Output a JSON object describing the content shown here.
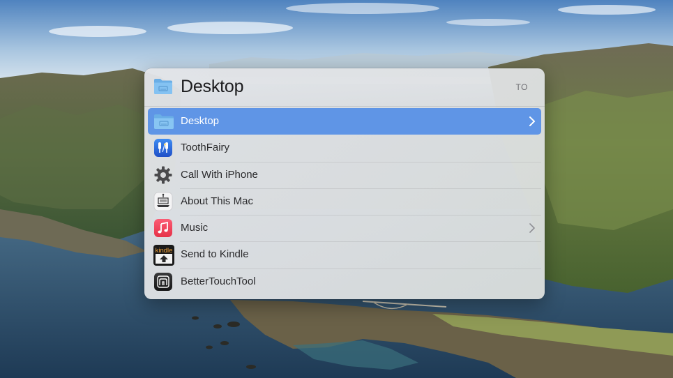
{
  "header": {
    "title": "Desktop",
    "shortcut": "TO",
    "icon": "folder-icon"
  },
  "items": [
    {
      "label": "Desktop",
      "icon": "folder-icon",
      "selected": true,
      "has_submenu": true
    },
    {
      "label": "ToothFairy",
      "icon": "toothfairy-icon",
      "selected": false,
      "has_submenu": false
    },
    {
      "label": "Call With iPhone",
      "icon": "gear-icon",
      "selected": false,
      "has_submenu": false
    },
    {
      "label": "About This Mac",
      "icon": "about-mac-icon",
      "selected": false,
      "has_submenu": false
    },
    {
      "label": "Music",
      "icon": "music-icon",
      "selected": false,
      "has_submenu": true
    },
    {
      "label": "Send to Kindle",
      "icon": "kindle-icon",
      "selected": false,
      "has_submenu": false
    },
    {
      "label": "BetterTouchTool",
      "icon": "bettertouchtool-icon",
      "selected": false,
      "has_submenu": false
    }
  ],
  "kindle_icon_text": "kindle",
  "colors": {
    "selection": "#5f95e6",
    "folder": "#6fb3ea",
    "music": "#f04a5a"
  }
}
